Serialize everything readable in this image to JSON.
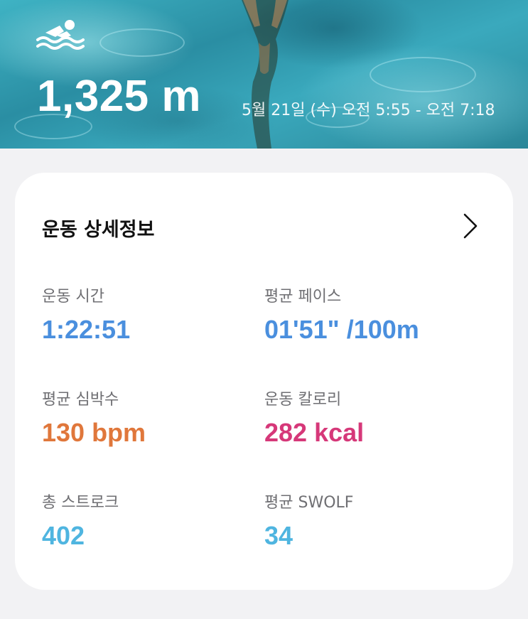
{
  "header": {
    "activity_icon": "swimming-icon",
    "distance": "1,325 m",
    "date_range": "5월 21일 (수) 오전 5:55 - 오전 7:18"
  },
  "card": {
    "title": "운동 상세정보",
    "chevron_icon": "chevron-right-icon",
    "stats": [
      {
        "label": "운동 시간",
        "value": "1:22:51",
        "color": "#4a8fde"
      },
      {
        "label": "평균 페이스",
        "value": "01'51\" /100m",
        "color": "#4a8fde"
      },
      {
        "label": "평균 심박수",
        "value": "130 bpm",
        "color": "#e0773b"
      },
      {
        "label": "운동 칼로리",
        "value": "282 kcal",
        "color": "#d63879"
      },
      {
        "label": "총 스트로크",
        "value": "402",
        "color": "#4fb5e0"
      },
      {
        "label": "평균 SWOLF",
        "value": "34",
        "color": "#4fb5e0"
      }
    ]
  }
}
